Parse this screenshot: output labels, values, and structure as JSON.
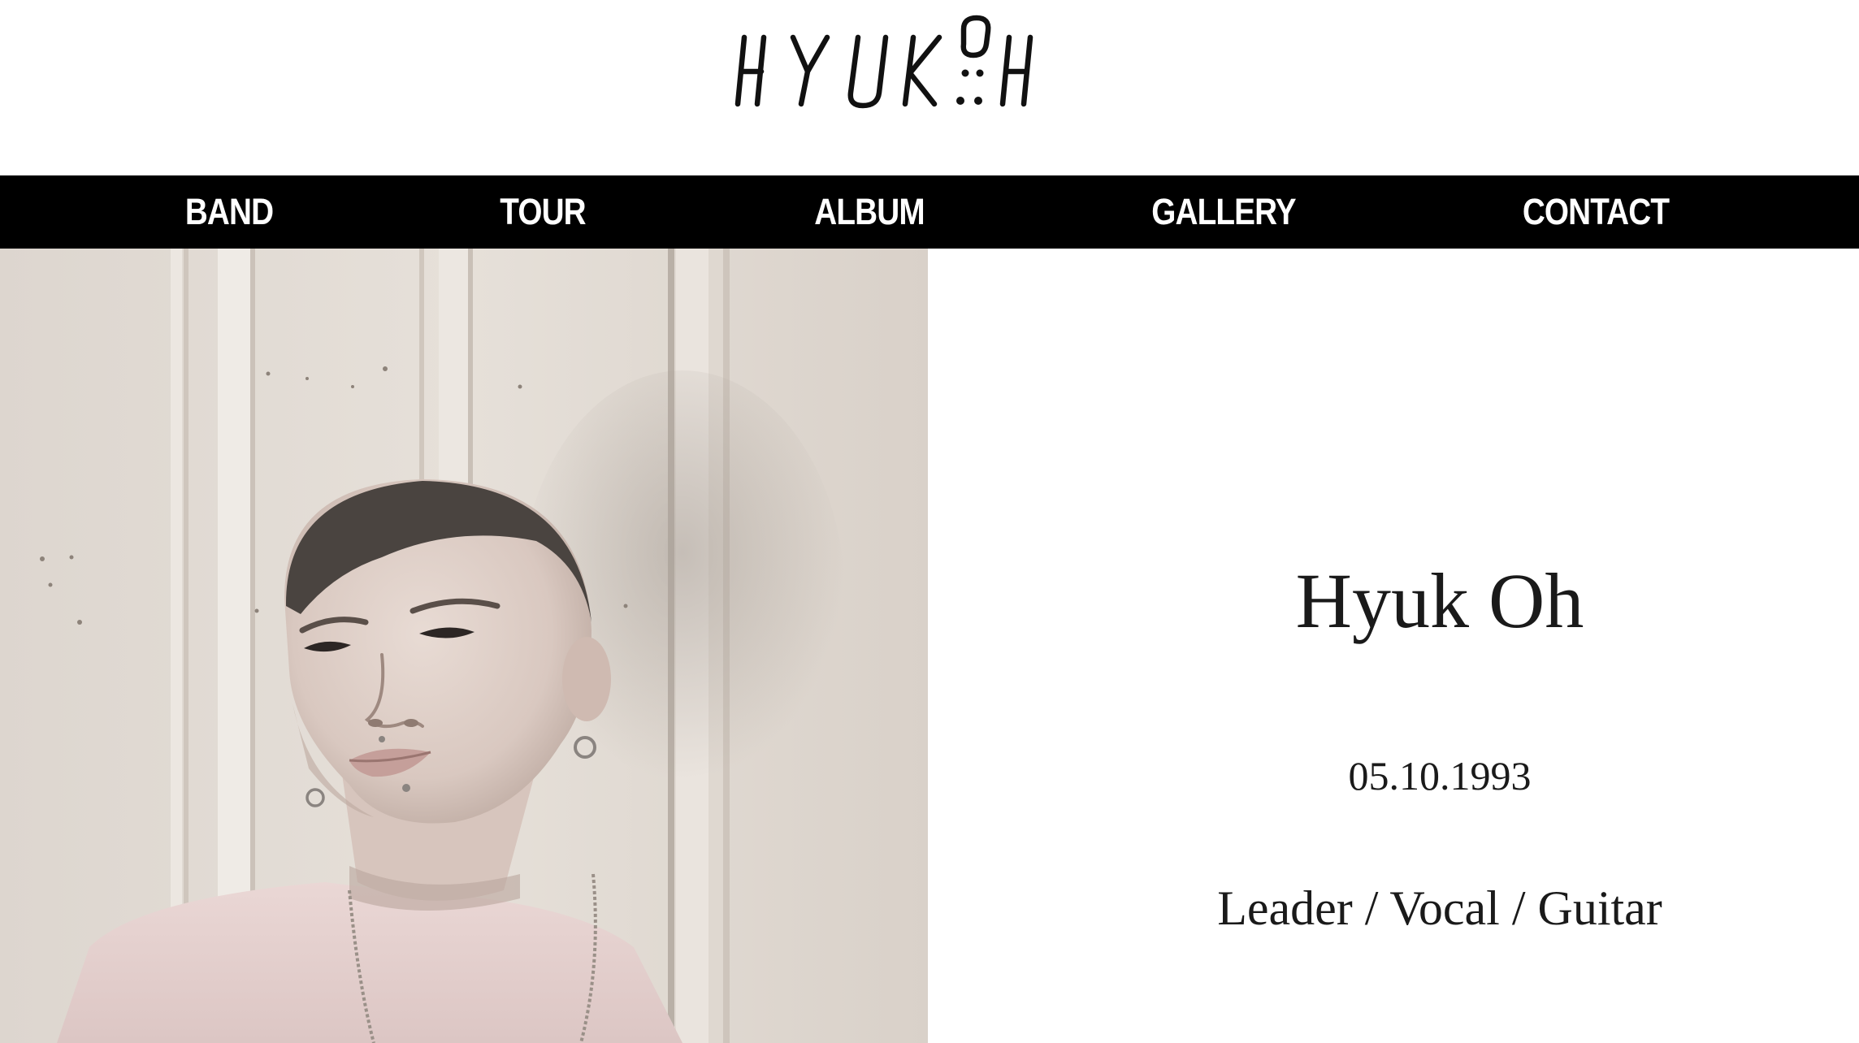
{
  "header": {
    "logo_text": "HYUKOH"
  },
  "nav": {
    "items": [
      {
        "label": "BAND"
      },
      {
        "label": "TOUR"
      },
      {
        "label": "ALBUM"
      },
      {
        "label": "GALLERY"
      },
      {
        "label": "CONTACT"
      }
    ]
  },
  "profile": {
    "name": "Hyuk Oh",
    "birthdate": "05.10.1993",
    "role": "Leader / Vocal / Guitar"
  },
  "colors": {
    "nav_background": "#000000",
    "nav_text": "#ffffff",
    "body_text": "#1a1a1a",
    "page_background": "#ffffff"
  }
}
